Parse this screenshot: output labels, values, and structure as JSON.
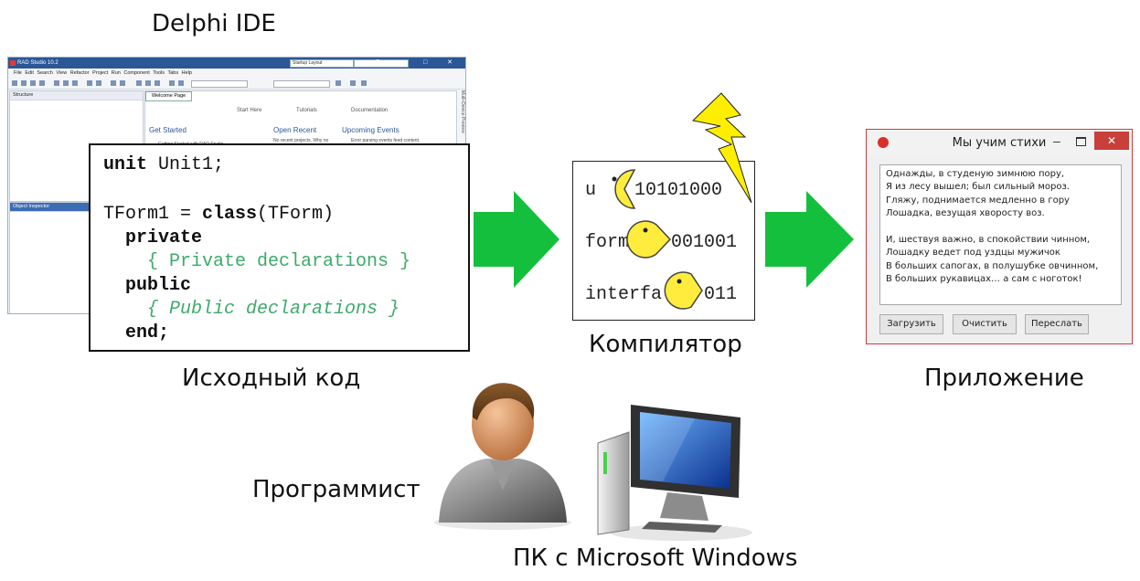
{
  "captions": {
    "ide": "Delphi IDE",
    "source": "Исходный код",
    "compiler": "Компилятор",
    "app": "Приложение",
    "programmer": "Программист",
    "pc": "ПК с Microsoft Windows"
  },
  "ide_window": {
    "title": "RAD Studio 10.2",
    "layout": "Startup Layout",
    "menu": [
      "File",
      "Edit",
      "Search",
      "View",
      "Refactor",
      "Project",
      "Run",
      "Component",
      "Tools",
      "Tabs",
      "Help"
    ],
    "structure_panel": "Structure",
    "object_inspector": "Object Inspector",
    "welcome_tab": "Welcome Page",
    "nav": [
      "Start Here",
      "Tutorials",
      "Documentation"
    ],
    "sections": [
      "Get Started",
      "Open Recent",
      "Upcoming Events"
    ],
    "get_started_item": "Getting Started with RAD Studio",
    "recent_text": "No recent projects. Why no",
    "events_text": "Error parsing events feed content.",
    "side_label": "Multi-Device Preview"
  },
  "code": {
    "l1_kw": "unit",
    "l1_rest": " Unit1;",
    "l3_a": "TForm1 = ",
    "l3_kw": "class",
    "l3_b": "(TForm)",
    "l4": "private",
    "l5": "{ Private declarations }",
    "l6": "public",
    "l7": "{ Public declarations }",
    "l8": "end;"
  },
  "compiler_box": {
    "row1_word": "u",
    "row1_bits": "10101000",
    "row2_word": "form",
    "row2_bits": "001001",
    "row3_word": "interfa",
    "row3_bits": "011"
  },
  "app_window": {
    "title": "Мы учим стихи",
    "close": "✕",
    "minimize": "–",
    "poem": "Однажды, в студеную зимнюю пору,\nЯ из лесу вышел; был сильный мороз.\nГляжу, поднимается медленно в гору\nЛошадка, везущая хворосту воз.\n\nИ, шествуя важно, в спокойствии чинном,\nЛошадку ведет под уздцы мужичок\nВ больших сапогах, в полушубке овчинном,\nВ больших рукавицах… а сам с ноготок!",
    "buttons": [
      "Загрузить",
      "Очистить",
      "Переслать"
    ]
  },
  "colors": {
    "arrow": "#15bf3e",
    "lightning": "#ffee00",
    "pacman": "#ffec3d",
    "comment": "#3daa6a",
    "close_btn": "#c9403a"
  },
  "icons": [
    "lightning-icon",
    "pacman-icon",
    "programmer-icon",
    "computer-icon",
    "app-icon"
  ]
}
